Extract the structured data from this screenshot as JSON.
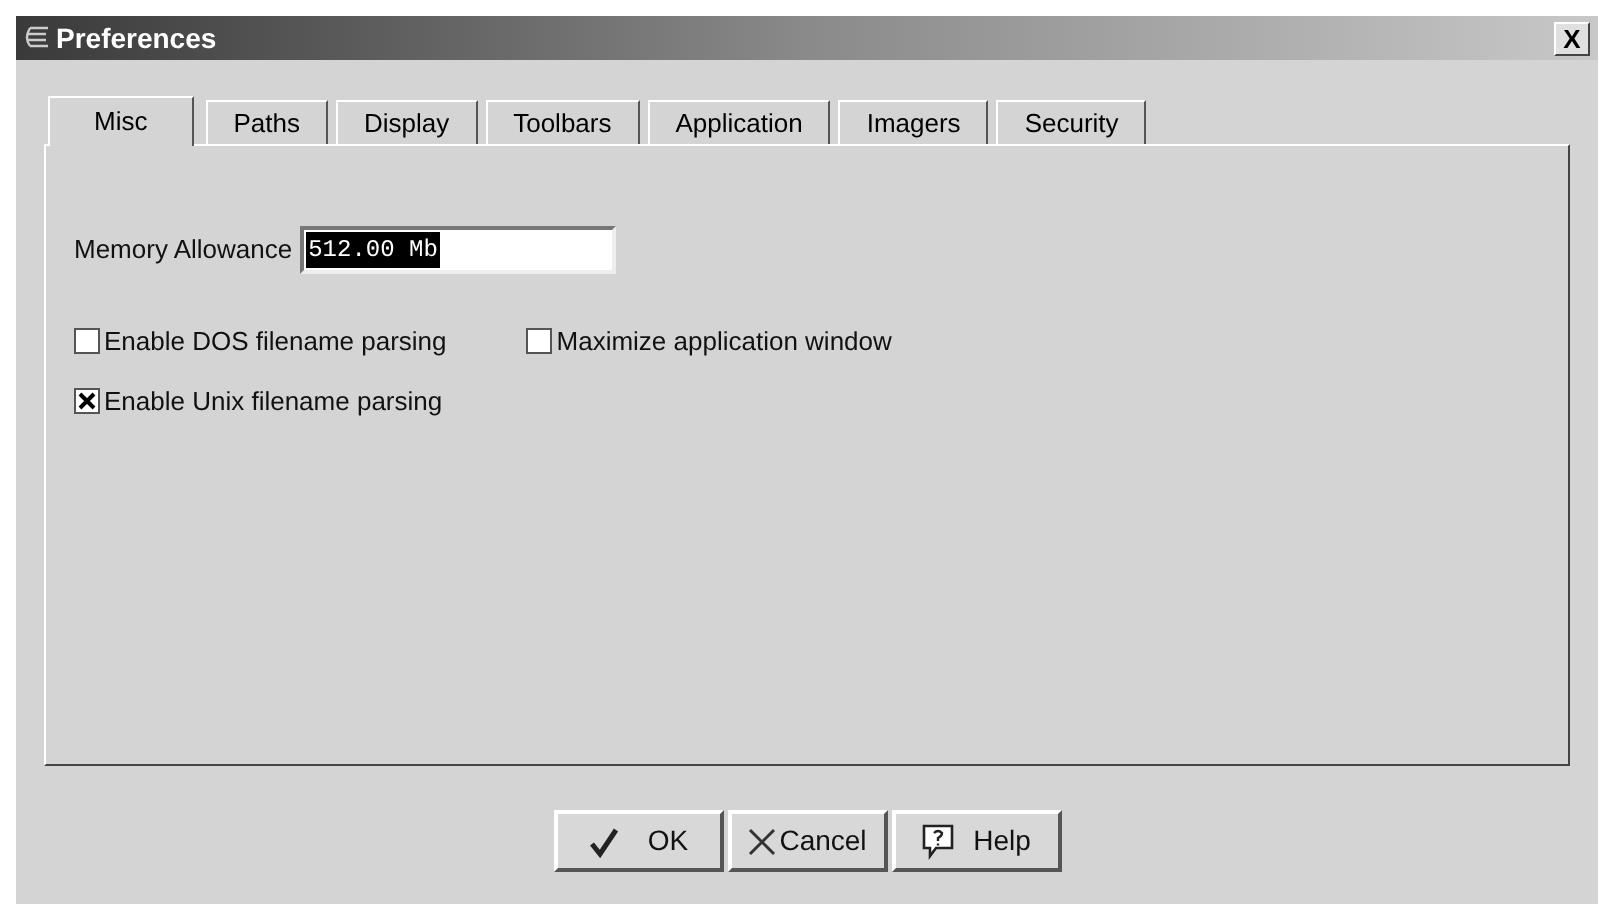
{
  "window": {
    "title": "Preferences",
    "close": "X"
  },
  "tabs": [
    {
      "label": "Misc",
      "selected": true
    },
    {
      "label": "Paths",
      "selected": false
    },
    {
      "label": "Display",
      "selected": false
    },
    {
      "label": "Toolbars",
      "selected": false
    },
    {
      "label": "Application",
      "selected": false
    },
    {
      "label": "Imagers",
      "selected": false
    },
    {
      "label": "Security",
      "selected": false
    }
  ],
  "memory": {
    "label": "Memory Allowance",
    "value": "512.00 Mb",
    "highlighted": true
  },
  "options": [
    {
      "label": "Enable DOS filename parsing",
      "checked": false
    },
    {
      "label": "Maximize application window",
      "checked": false
    },
    {
      "label": "Enable Unix filename parsing",
      "checked": true
    }
  ],
  "buttons": [
    {
      "label": "OK",
      "kind": "ok"
    },
    {
      "label": "Cancel",
      "kind": "cancel"
    },
    {
      "label": "Help",
      "kind": "help"
    }
  ]
}
